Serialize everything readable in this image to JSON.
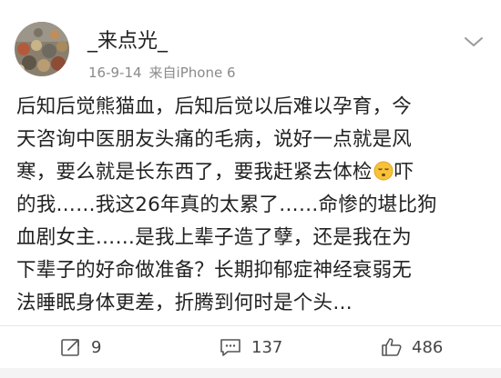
{
  "post": {
    "username": "_来点光_",
    "date": "16-9-14",
    "source": "来自iPhone 6",
    "lines": [
      "后知后觉熊猫血，后知后觉以后难以孕育，今",
      "天咨询中医朋友头痛的毛病，说好一点就是风",
      "寒，要么就是长东西了，要我赶紧去体检",
      "吓",
      "的我……我这26年真的太累了……命惨的堪比狗",
      "血剧女主……是我上辈子造了孽，还是我在为",
      "下辈子的好命做准备？长期抑郁症神经衰弱无",
      "法睡眠身体更差，折腾到何时是个头…"
    ]
  },
  "actions": {
    "repost_count": "9",
    "comment_count": "137",
    "like_count": "486"
  },
  "icons": {
    "avatar": "avatar-photo",
    "menu": "chevron-down-icon",
    "emoji": "sad-face-emoji-icon",
    "repost": "repost-icon",
    "comment": "comment-icon",
    "like": "thumbs-up-icon"
  },
  "colors": {
    "text": "#222222",
    "meta": "#8a8a8a",
    "divider": "#e6e6e6",
    "emoji": "#f7c23a"
  }
}
